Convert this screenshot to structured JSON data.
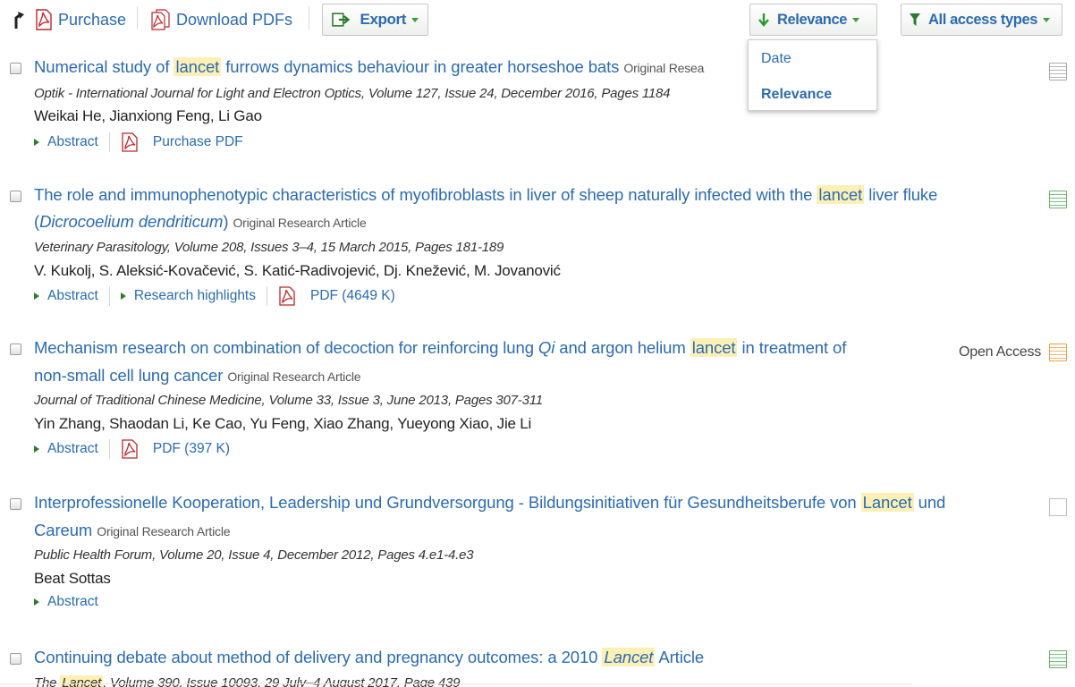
{
  "toolbar": {
    "purchase_label": "Purchase",
    "download_label": "Download PDFs",
    "export_label": "Export",
    "sort_label": "Relevance",
    "access_label": "All access types"
  },
  "sort_menu": {
    "options": [
      "Date",
      "Relevance"
    ],
    "selected": "Relevance"
  },
  "results": [
    {
      "title_before": "Numerical study of ",
      "title_highlight": "lancet",
      "title_after": " furrows dynamics behaviour in greater horseshoe bats",
      "type": "Original Resea",
      "source": "Optik - International Journal for Light and Electron Optics, Volume 127, Issue 24, December 2016, Pages 1184",
      "authors": "Weikai He, Jianxiong Feng, Li Gao",
      "actions": [
        "Abstract",
        "Purchase PDF"
      ],
      "icon": "grey"
    },
    {
      "title_line1_before": "The role and immunophenotypic characteristics of myofibroblasts in liver of sheep naturally infected with the ",
      "title_highlight": "lancet",
      "title_line1_after": " liver fluke",
      "title_line2_open": "(",
      "title_line2_italic": "Dicrocoelium dendriticum",
      "title_line2_close": ")",
      "type": "Original Research Article",
      "source": "Veterinary Parasitology, Volume 208, Issues 3–4, 15 March 2015, Pages 181-189",
      "authors": "V. Kukolj, S. Aleksić-Kovačević, S. Katić-Radivojević, Dj. Knežević, M. Jovanović",
      "actions": [
        "Abstract",
        "Research highlights",
        "PDF (4649 K)"
      ],
      "icon": "green"
    },
    {
      "title_line1_before": "Mechanism research on combination of decoction for reinforcing lung ",
      "title_italic": "Qi",
      "title_line1_mid": " and argon helium ",
      "title_highlight": "lancet",
      "title_line1_after": " in treatment of",
      "title_line2": "non-small cell lung cancer",
      "type": "Original Research Article",
      "source": "Journal of Traditional Chinese Medicine, Volume 33, Issue 3, June 2013, Pages 307-311",
      "authors": "Yin Zhang, Shaodan Li, Ke Cao, Yu Feng, Xiao Zhang, Yueyong Xiao, Jie Li",
      "actions": [
        "Abstract",
        "PDF (397 K)"
      ],
      "access": "Open Access",
      "icon": "orange"
    },
    {
      "title_line1_before": "Interprofessionelle Kooperation, Leadership und Grundversorgung - Bildungsinitiativen für Gesundheitsberufe von ",
      "title_highlight": "Lancet",
      "title_line1_after": " und",
      "title_line2": "Careum",
      "type": "Original Research Article",
      "source": "Public Health Forum, Volume 20, Issue 4, December 2012, Pages 4.e1-4.e3",
      "authors": "Beat Sottas",
      "actions": [
        "Abstract"
      ],
      "icon": "empty"
    },
    {
      "title_before": "Continuing debate about method of delivery and pregnancy outcomes: a 2010 ",
      "title_highlight": "Lancet",
      "title_after": " Article",
      "source_partial_before": "The ",
      "source_partial_highlight": "Lancet",
      "source_partial_after": ", Volume 390, Issue 10093, 29 July–4 August 2017, Page 439",
      "icon": "green"
    }
  ]
}
